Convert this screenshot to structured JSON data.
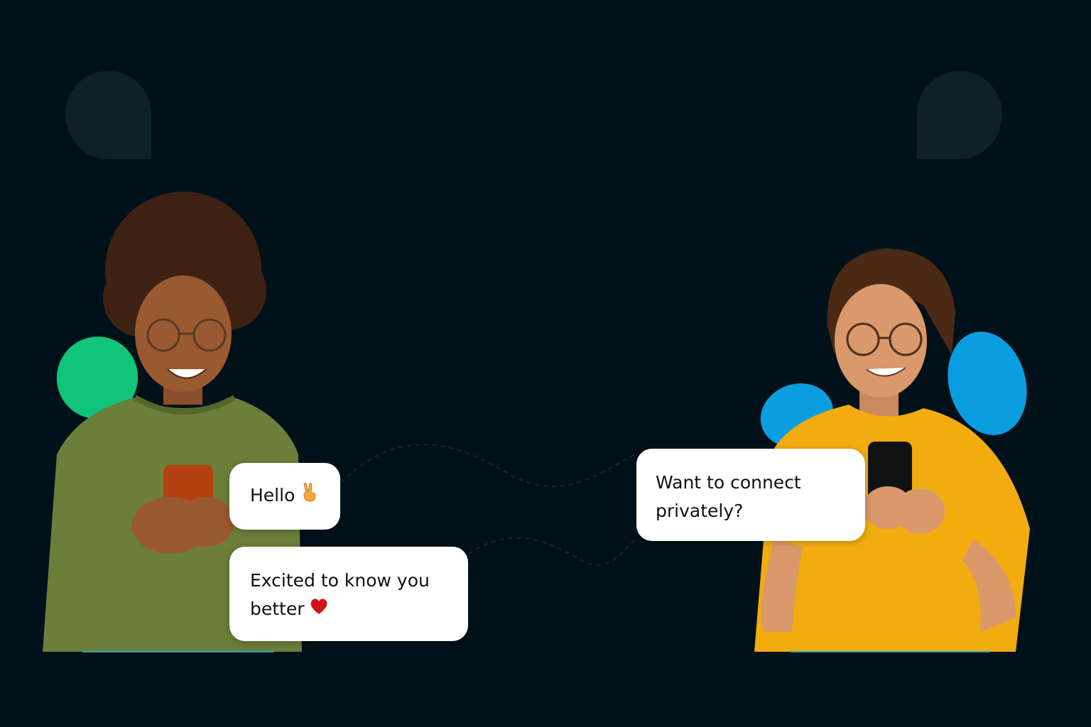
{
  "messages": {
    "hello": {
      "text": "Hello",
      "emoji_icon": "victory-hand-icon"
    },
    "excited": {
      "line1": "Excited to know you",
      "line2": "better",
      "emoji_icon": "red-heart-icon"
    },
    "connect": {
      "line1": "Want to connect",
      "line2": "privately?"
    }
  },
  "colors": {
    "background": "#01111a",
    "bubble": "#ffffff",
    "green_accent": "#10c47a",
    "blue_accent": "#0a9ee0",
    "left_sweater": "#6b7f3a",
    "right_shirt": "#f2ac0f"
  },
  "icons": {
    "left_speech_shape": "speech-bubble-shape-icon",
    "right_speech_shape": "speech-bubble-shape-icon"
  }
}
